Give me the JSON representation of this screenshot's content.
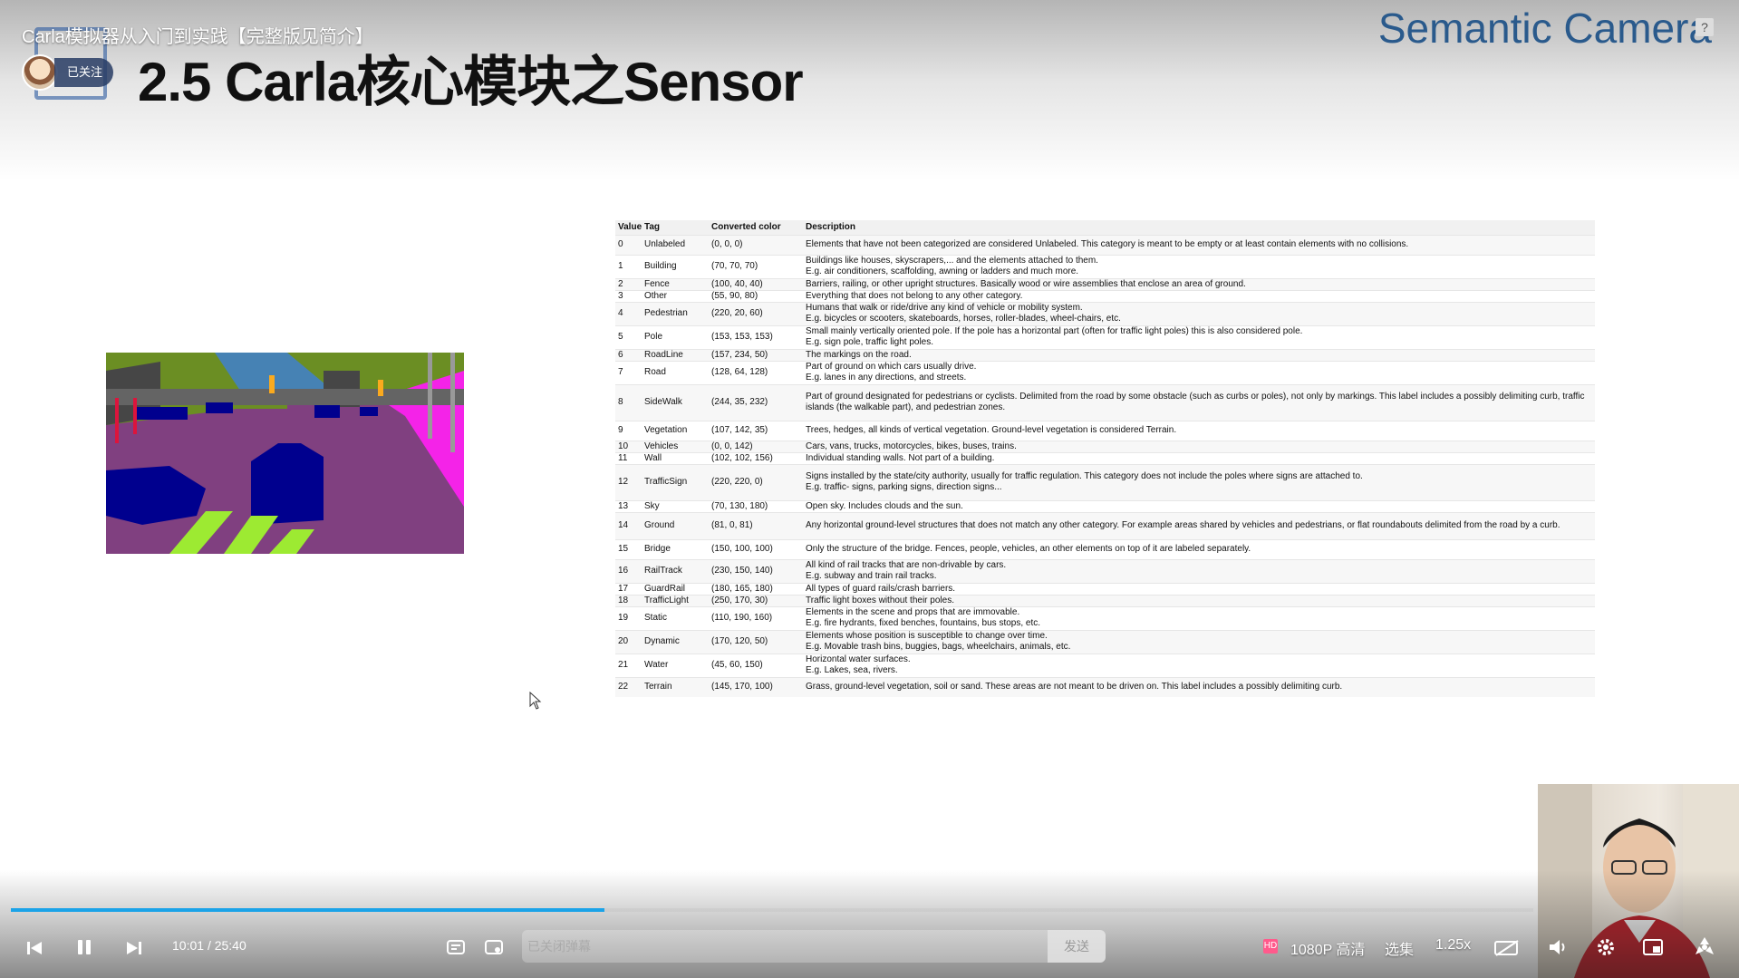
{
  "video": {
    "title": "Carla模拟器从入门到实践【完整版见简介】",
    "follow_label": "已关注"
  },
  "slide": {
    "title": "2.5 Carla核心模块之Sensor",
    "corner_title": "Semantic Camera",
    "help_glyph": "?"
  },
  "table": {
    "headers": [
      "Value",
      "Tag",
      "Converted color",
      "Description"
    ],
    "rows": [
      {
        "value": "0",
        "tag": "Unlabeled",
        "color": "(0, 0, 0)",
        "desc": "Elements that have not been categorized are considered Unlabeled. This category is meant to be empty or at least contain elements with no collisions."
      },
      {
        "value": "1",
        "tag": "Building",
        "color": "(70, 70, 70)",
        "desc": "Buildings like houses, skyscrapers,... and the elements attached to them.\nE.g. air conditioners, scaffolding, awning or ladders and much more."
      },
      {
        "value": "2",
        "tag": "Fence",
        "color": "(100, 40, 40)",
        "desc": "Barriers, railing, or other upright structures. Basically wood or wire assemblies that enclose an area of ground."
      },
      {
        "value": "3",
        "tag": "Other",
        "color": "(55, 90, 80)",
        "desc": "Everything that does not belong to any other category."
      },
      {
        "value": "4",
        "tag": "Pedestrian",
        "color": "(220, 20, 60)",
        "desc": "Humans that walk or ride/drive any kind of vehicle or mobility system.\nE.g. bicycles or scooters, skateboards, horses, roller-blades, wheel-chairs, etc."
      },
      {
        "value": "5",
        "tag": "Pole",
        "color": "(153, 153, 153)",
        "desc": "Small mainly vertically oriented pole. If the pole has a horizontal part (often for traffic light poles) this is also considered pole.\nE.g. sign pole, traffic light poles."
      },
      {
        "value": "6",
        "tag": "RoadLine",
        "color": "(157, 234, 50)",
        "desc": "The markings on the road."
      },
      {
        "value": "7",
        "tag": "Road",
        "color": "(128, 64, 128)",
        "desc": "Part of ground on which cars usually drive.\nE.g. lanes in any directions, and streets."
      },
      {
        "value": "8",
        "tag": "SideWalk",
        "color": "(244, 35, 232)",
        "desc": "Part of ground designated for pedestrians or cyclists. Delimited from the road by some obstacle (such as curbs or poles), not only by markings. This label includes a possibly delimiting curb, traffic islands (the walkable part), and pedestrian zones."
      },
      {
        "value": "9",
        "tag": "Vegetation",
        "color": "(107, 142, 35)",
        "desc": "Trees, hedges, all kinds of vertical vegetation. Ground-level vegetation is considered Terrain."
      },
      {
        "value": "10",
        "tag": "Vehicles",
        "color": "(0, 0, 142)",
        "desc": "Cars, vans, trucks, motorcycles, bikes, buses, trains."
      },
      {
        "value": "11",
        "tag": "Wall",
        "color": "(102, 102, 156)",
        "desc": "Individual standing walls. Not part of a building."
      },
      {
        "value": "12",
        "tag": "TrafficSign",
        "color": "(220, 220, 0)",
        "desc": "Signs installed by the state/city authority, usually for traffic regulation. This category does not include the poles where signs are attached to.\nE.g. traffic- signs, parking signs, direction signs..."
      },
      {
        "value": "13",
        "tag": "Sky",
        "color": "(70, 130, 180)",
        "desc": "Open sky. Includes clouds and the sun."
      },
      {
        "value": "14",
        "tag": "Ground",
        "color": "(81, 0, 81)",
        "desc": "Any horizontal ground-level structures that does not match any other category. For example areas shared by vehicles and pedestrians, or flat roundabouts delimited from the road by a curb."
      },
      {
        "value": "15",
        "tag": "Bridge",
        "color": "(150, 100, 100)",
        "desc": "Only the structure of the bridge. Fences, people, vehicles, an other elements on top of it are labeled separately."
      },
      {
        "value": "16",
        "tag": "RailTrack",
        "color": "(230, 150, 140)",
        "desc": "All kind of rail tracks that are non-drivable by cars.\nE.g. subway and train rail tracks."
      },
      {
        "value": "17",
        "tag": "GuardRail",
        "color": "(180, 165, 180)",
        "desc": "All types of guard rails/crash barriers."
      },
      {
        "value": "18",
        "tag": "TrafficLight",
        "color": "(250, 170, 30)",
        "desc": "Traffic light boxes without their poles."
      },
      {
        "value": "19",
        "tag": "Static",
        "color": "(110, 190, 160)",
        "desc": "Elements in the scene and props that are immovable.\nE.g. fire hydrants, fixed benches, fountains, bus stops, etc."
      },
      {
        "value": "20",
        "tag": "Dynamic",
        "color": "(170, 120, 50)",
        "desc": "Elements whose position is susceptible to change over time.\nE.g. Movable trash bins, buggies, bags, wheelchairs, animals, etc."
      },
      {
        "value": "21",
        "tag": "Water",
        "color": "(45, 60, 150)",
        "desc": "Horizontal water surfaces.\nE.g. Lakes, sea, rivers."
      },
      {
        "value": "22",
        "tag": "Terrain",
        "color": "(145, 170, 100)",
        "desc": "Grass, ground-level vegetation, soil or sand. These areas are not meant to be driven on. This label includes a possibly delimiting curb."
      }
    ]
  },
  "player": {
    "time_current": "10:01",
    "time_total": "25:40",
    "progress_fraction": 0.39,
    "danmaku_placeholder": "已关闭弹幕",
    "send_label": "发送",
    "quality_label": "1080P 高清",
    "episodes_label": "选集",
    "speed_label": "1.25x",
    "accent_color": "#1aa3e8"
  }
}
